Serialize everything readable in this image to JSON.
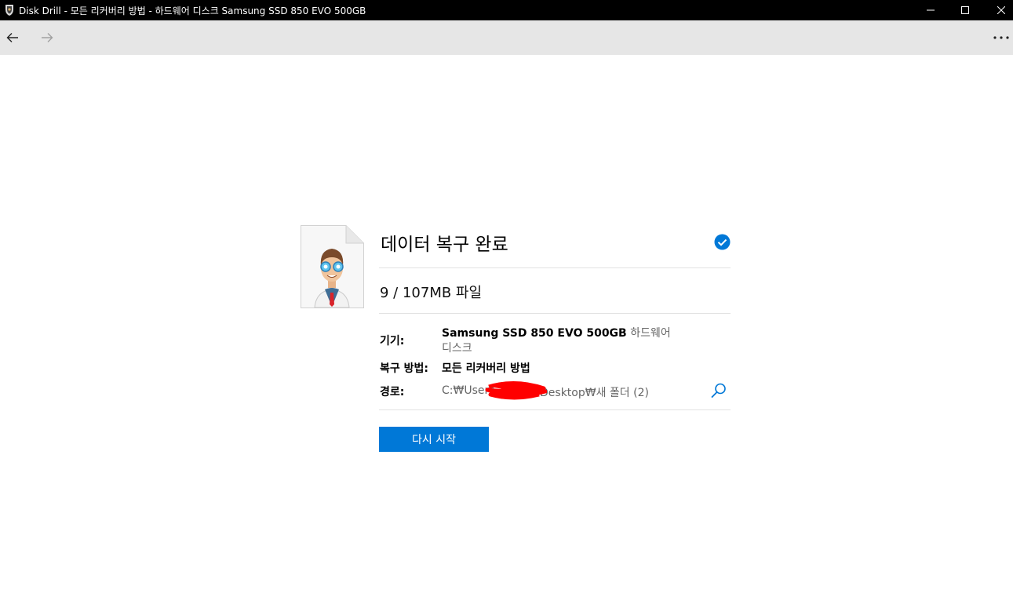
{
  "window": {
    "title": "Disk Drill - 모든 리커버리 방법 - 하드웨어 디스크 Samsung SSD 850 EVO 500GB",
    "controls": [
      "minimize-icon",
      "maximize-icon",
      "close-icon"
    ]
  },
  "nav": {
    "back_icon": "arrow-left-icon",
    "forward_icon": "arrow-right-icon",
    "more_icon": "more-dots-icon"
  },
  "result": {
    "heading": "데이터 복구 완료",
    "files_summary": "9 / 107MB 파일",
    "device_label": "기기:",
    "device_name": "Samsung SSD 850 EVO 500GB",
    "device_type_line1": "하드웨어",
    "device_type_line2": "디스크",
    "method_label": "복구 방법:",
    "method_value": "모든 리커버리 방법",
    "path_label": "경로:",
    "path_prefix": "C:₩Users",
    "path_suffix": "Desktop₩새 폴더 (2)",
    "restart_label": "다시 시작"
  },
  "colors": {
    "accent": "#0078d7",
    "titlebar": "#000000",
    "navbar": "#e6e6e6",
    "redaction": "#ff0000"
  }
}
